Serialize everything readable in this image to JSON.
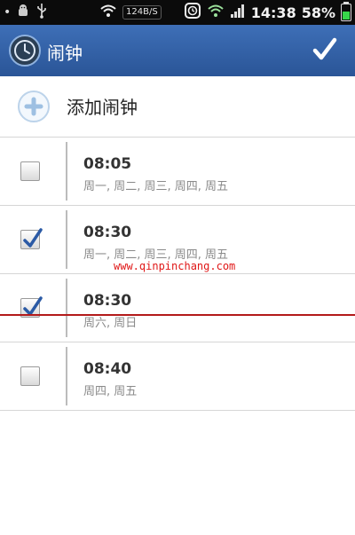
{
  "status_bar": {
    "network_speed": "124B/S",
    "time": "14:38",
    "battery": "58%",
    "battery_level": 0.58,
    "icons": [
      "usb-icon",
      "wifi-icon",
      "alarm-clock-icon",
      "signal-icon",
      "battery-icon"
    ]
  },
  "header": {
    "title": "闹钟",
    "confirm_icon": "checkmark-icon"
  },
  "add_alarm": {
    "label": "添加闹钟",
    "icon": "plus-circle-icon"
  },
  "alarms": [
    {
      "time": "08:05",
      "days": "周一, 周二, 周三, 周四, 周五",
      "enabled": false
    },
    {
      "time": "08:30",
      "days": "周一, 周二, 周三, 周四, 周五",
      "enabled": true
    },
    {
      "time": "08:30",
      "days": "周六, 周日",
      "enabled": true
    },
    {
      "time": "08:40",
      "days": "周四, 周五",
      "enabled": false
    }
  ],
  "watermark": "www.qinpinchang.com",
  "colors": {
    "header_bg": "#3561a8",
    "status_bar_bg": "#0b0b0b",
    "checkmark": "#2b5aa5",
    "watermark": "#e01717"
  }
}
